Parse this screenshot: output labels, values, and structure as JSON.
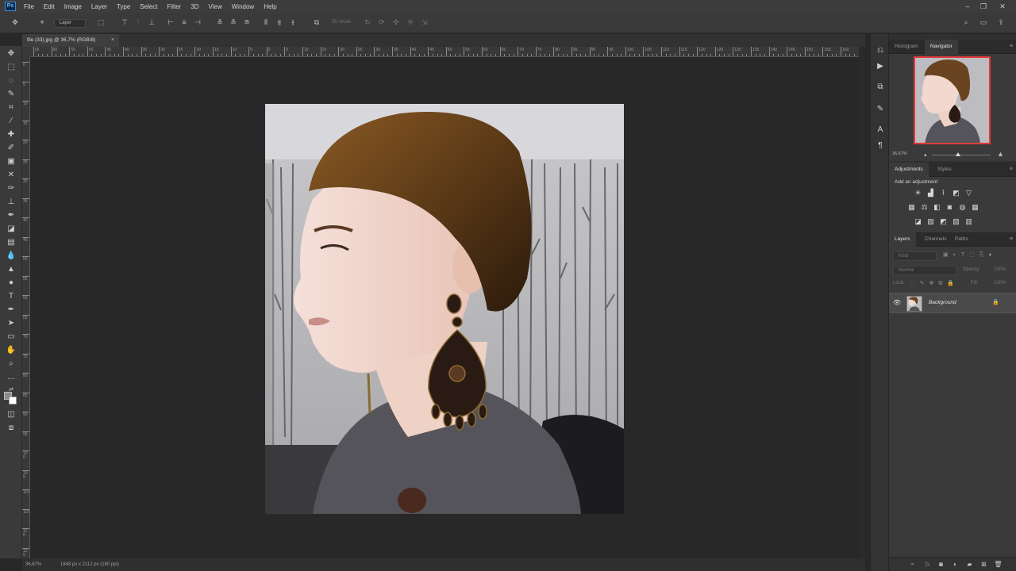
{
  "app": {
    "logo": "Ps",
    "menu": [
      "File",
      "Edit",
      "Image",
      "Layer",
      "Type",
      "Select",
      "Filter",
      "3D",
      "View",
      "Window",
      "Help"
    ]
  },
  "options_bar": {
    "auto_select_value": "Layer",
    "mode_3d_label": "3D Mode:"
  },
  "document": {
    "tab_title": "file (33).jpg @ 36,7% (RGB/8)",
    "tab_close": "×",
    "zoom": "36,67%",
    "doc_info": "1848 px x 2112 px (180 ppi)"
  },
  "ruler": {
    "h_labels": [
      "65",
      "60",
      "55",
      "50",
      "45",
      "40",
      "35",
      "30",
      "25",
      "20",
      "15",
      "10",
      "5",
      "0",
      "5",
      "10",
      "15",
      "20",
      "25",
      "30",
      "35",
      "40",
      "45",
      "50",
      "55",
      "60",
      "65",
      "70",
      "75",
      "80",
      "85",
      "90",
      "95",
      "100",
      "105",
      "110",
      "115",
      "120",
      "125",
      "130",
      "135",
      "140",
      "145",
      "150",
      "155",
      "160"
    ],
    "v_labels": [
      "0",
      "5",
      "10",
      "15",
      "20",
      "25",
      "30",
      "35",
      "40",
      "45",
      "50",
      "55",
      "60",
      "65",
      "70",
      "75",
      "80",
      "85",
      "90",
      "95",
      "100",
      "105",
      "110",
      "115",
      "120",
      "125"
    ]
  },
  "panels": {
    "navigator": {
      "tabs": [
        "Histogram",
        "Navigator"
      ],
      "active_tab": "Navigator",
      "zoom": "36,67%"
    },
    "adjustments": {
      "tabs": [
        "Adjustments",
        "Styles"
      ],
      "active_tab": "Adjustments",
      "hint": "Add an adjustment"
    },
    "layers": {
      "tabs": [
        "Layers",
        "Channels",
        "Paths"
      ],
      "active_tab": "Layers",
      "filter_placeholder": "Kind",
      "blend_mode": "Normal",
      "opacity_label": "Opacity:",
      "opacity_value": "100%",
      "lock_label": "Lock:",
      "fill_label": "Fill:",
      "fill_value": "100%",
      "items": [
        {
          "name": "Background",
          "visible": true,
          "locked": true
        }
      ]
    }
  },
  "colors": {
    "accent_selection": "#e03a3a",
    "ps_blue": "#3a8fd6"
  }
}
